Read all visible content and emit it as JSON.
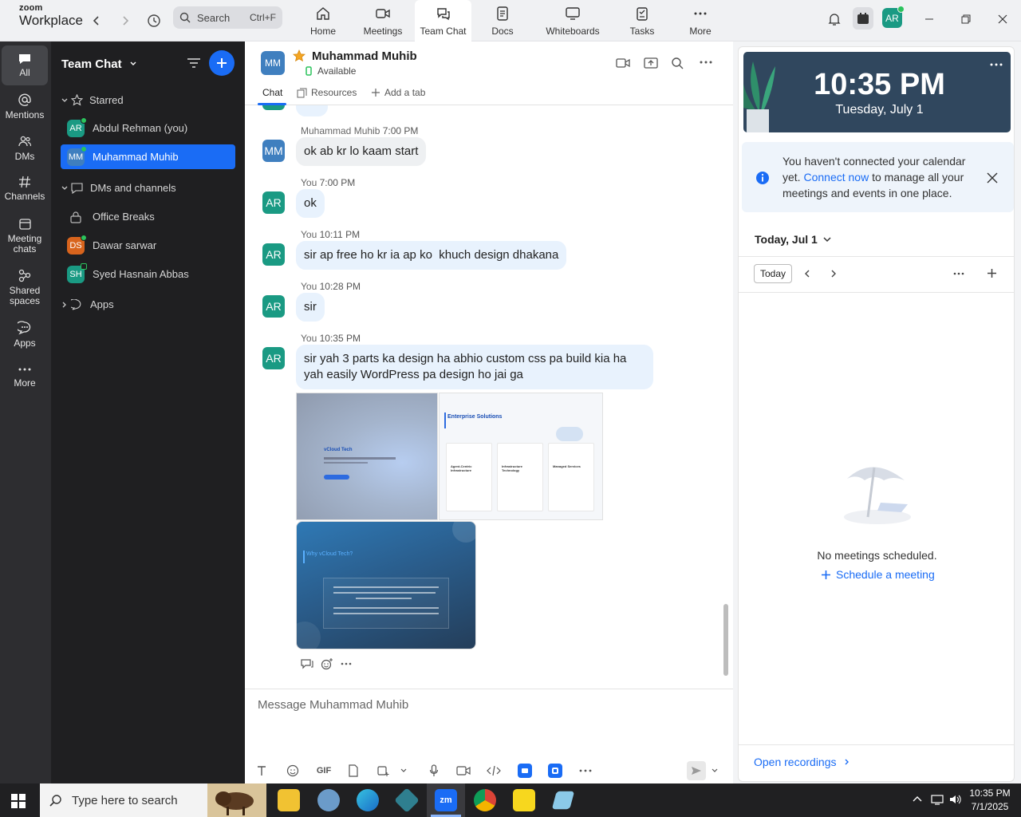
{
  "brand": {
    "top": "zoom",
    "bottom": "Workplace"
  },
  "search": {
    "label": "Search",
    "shortcut": "Ctrl+F"
  },
  "nav": [
    {
      "label": "Home",
      "icon": "home-icon"
    },
    {
      "label": "Meetings",
      "icon": "video-icon"
    },
    {
      "label": "Team Chat",
      "icon": "chat-icon"
    },
    {
      "label": "Docs",
      "icon": "doc-icon"
    },
    {
      "label": "Whiteboards",
      "icon": "whiteboard-icon"
    },
    {
      "label": "Tasks",
      "icon": "tasks-icon"
    },
    {
      "label": "More",
      "icon": "more-icon"
    }
  ],
  "user_initials": "AR",
  "rail": [
    {
      "label": "All"
    },
    {
      "label": "Mentions"
    },
    {
      "label": "DMs"
    },
    {
      "label": "Channels"
    },
    {
      "label": "Meeting chats"
    },
    {
      "label": "Shared spaces"
    },
    {
      "label": "Apps"
    },
    {
      "label": "More"
    }
  ],
  "panel": {
    "title": "Team Chat",
    "starred": "Starred",
    "contacts": [
      {
        "initials": "AR",
        "name": "Abdul Rehman (you)",
        "color": "#1a9a83"
      },
      {
        "initials": "MM",
        "name": "Muhammad Muhib",
        "color": "#3f7fbf"
      }
    ],
    "dms_header": "DMs and channels",
    "channels": [
      {
        "initials": "",
        "name": "Office Breaks",
        "color": ""
      },
      {
        "initials": "DS",
        "name": "Dawar sarwar",
        "color": "#d8641d"
      },
      {
        "initials": "SH",
        "name": "Syed Hasnain Abbas",
        "color": "#1a9a83"
      }
    ],
    "apps": "Apps"
  },
  "chat": {
    "initials": "MM",
    "name": "Muhammad Muhib",
    "status": "Available",
    "tabs": {
      "chat": "Chat",
      "resources": "Resources",
      "add": "Add a tab"
    },
    "messages": [
      {
        "sender": "Muhammad Muhib",
        "time": "7:00 PM",
        "initials": "MM",
        "text": "ok ab kr lo kaam start"
      },
      {
        "sender": "You",
        "time": "7:00 PM",
        "initials": "AR",
        "text": "ok"
      },
      {
        "sender": "You",
        "time": "10:11 PM",
        "initials": "AR",
        "text": "sir ap free ho kr ia ap ko  khuch design dhakana"
      },
      {
        "sender": "You",
        "time": "10:28 PM",
        "initials": "AR",
        "text": "sir"
      },
      {
        "sender": "You",
        "time": "10:35 PM",
        "initials": "AR",
        "text": "sir yah 3 parts ka design ha abhio custom css pa build kia ha yah easily WordPress pa design ho jai ga"
      }
    ],
    "thumbs": {
      "t1_brand": "vCloud Tech",
      "t2_title": "Enterprise Solutions",
      "t2_cards": [
        "Agent-Centric Infrastructure",
        "Infrastructure Technology",
        "Managed Services"
      ],
      "t3_title": "Why vCloud Tech?"
    },
    "composer": {
      "placeholder": "Message Muhammad Muhib",
      "gif": "GIF"
    }
  },
  "right": {
    "time": "10:35 PM",
    "date": "Tuesday, July 1",
    "notice_a": "You haven't connected your calendar yet. ",
    "notice_link": "Connect now",
    "notice_b": " to manage all your meetings and events in one place.",
    "day_selector": "Today, Jul 1",
    "today_btn": "Today",
    "empty_text": "No meetings scheduled.",
    "schedule_link": "Schedule a meeting",
    "recordings": "Open recordings"
  },
  "taskbar": {
    "search": "Type here to search",
    "time": "10:35 PM",
    "date": "7/1/2025"
  }
}
